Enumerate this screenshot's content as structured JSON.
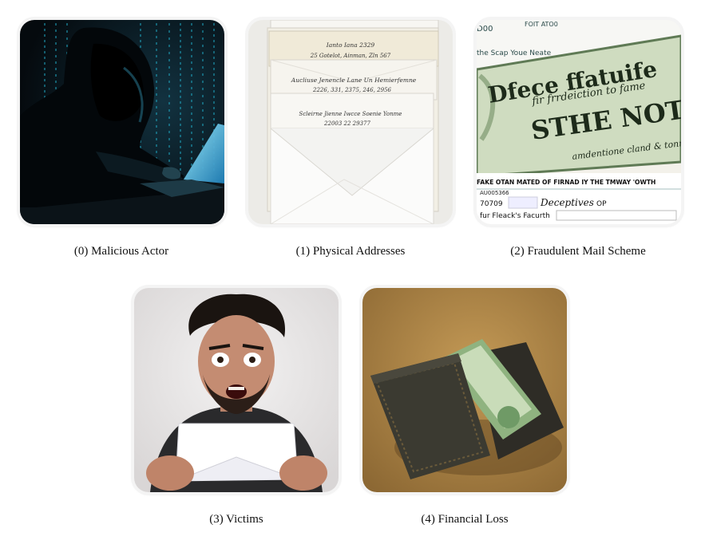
{
  "panels": [
    {
      "caption": "(0) Malicious Actor"
    },
    {
      "caption": "(1) Physical Addresses"
    },
    {
      "caption": "(2) Fraudulent Mail Scheme"
    },
    {
      "caption": "(3) Victims"
    },
    {
      "caption": "(4) Financial Loss"
    }
  ],
  "images": {
    "envelopes": {
      "lines": [
        "Ianto Iana 2329",
        "25 Gotelot, Ainman, Zln 567",
        "Aucliuse Jenencle Lane Un Hemierfemne",
        "2226, 331, 2375, 246, 2956",
        "Scleirne Jienne Iwcce Soenie Yonme",
        "22003 22 29377"
      ]
    },
    "scam_note": {
      "lines": [
        "D00",
        "FOIT ATO0",
        "the Scap Youe Neate",
        "Dfece ffatuife",
        "fir frrdeiction to fame",
        "STHE NOT",
        "amdentione cland & tonnes",
        "FAKE OTAN MATED OF FIRNAD IY THE TMWAY 'OWTH",
        "AU005366",
        "70709",
        "Deceptives",
        "OP",
        "fur Fleack's Facurth"
      ]
    }
  },
  "colors": {
    "dark_bg": "#071017",
    "matrix_cyan": "#1f9fb8",
    "laptop_glow": "#4fd3ff",
    "wallet": "#3b3a31",
    "table": "#b98a4a",
    "money_green": "#8fb380"
  }
}
